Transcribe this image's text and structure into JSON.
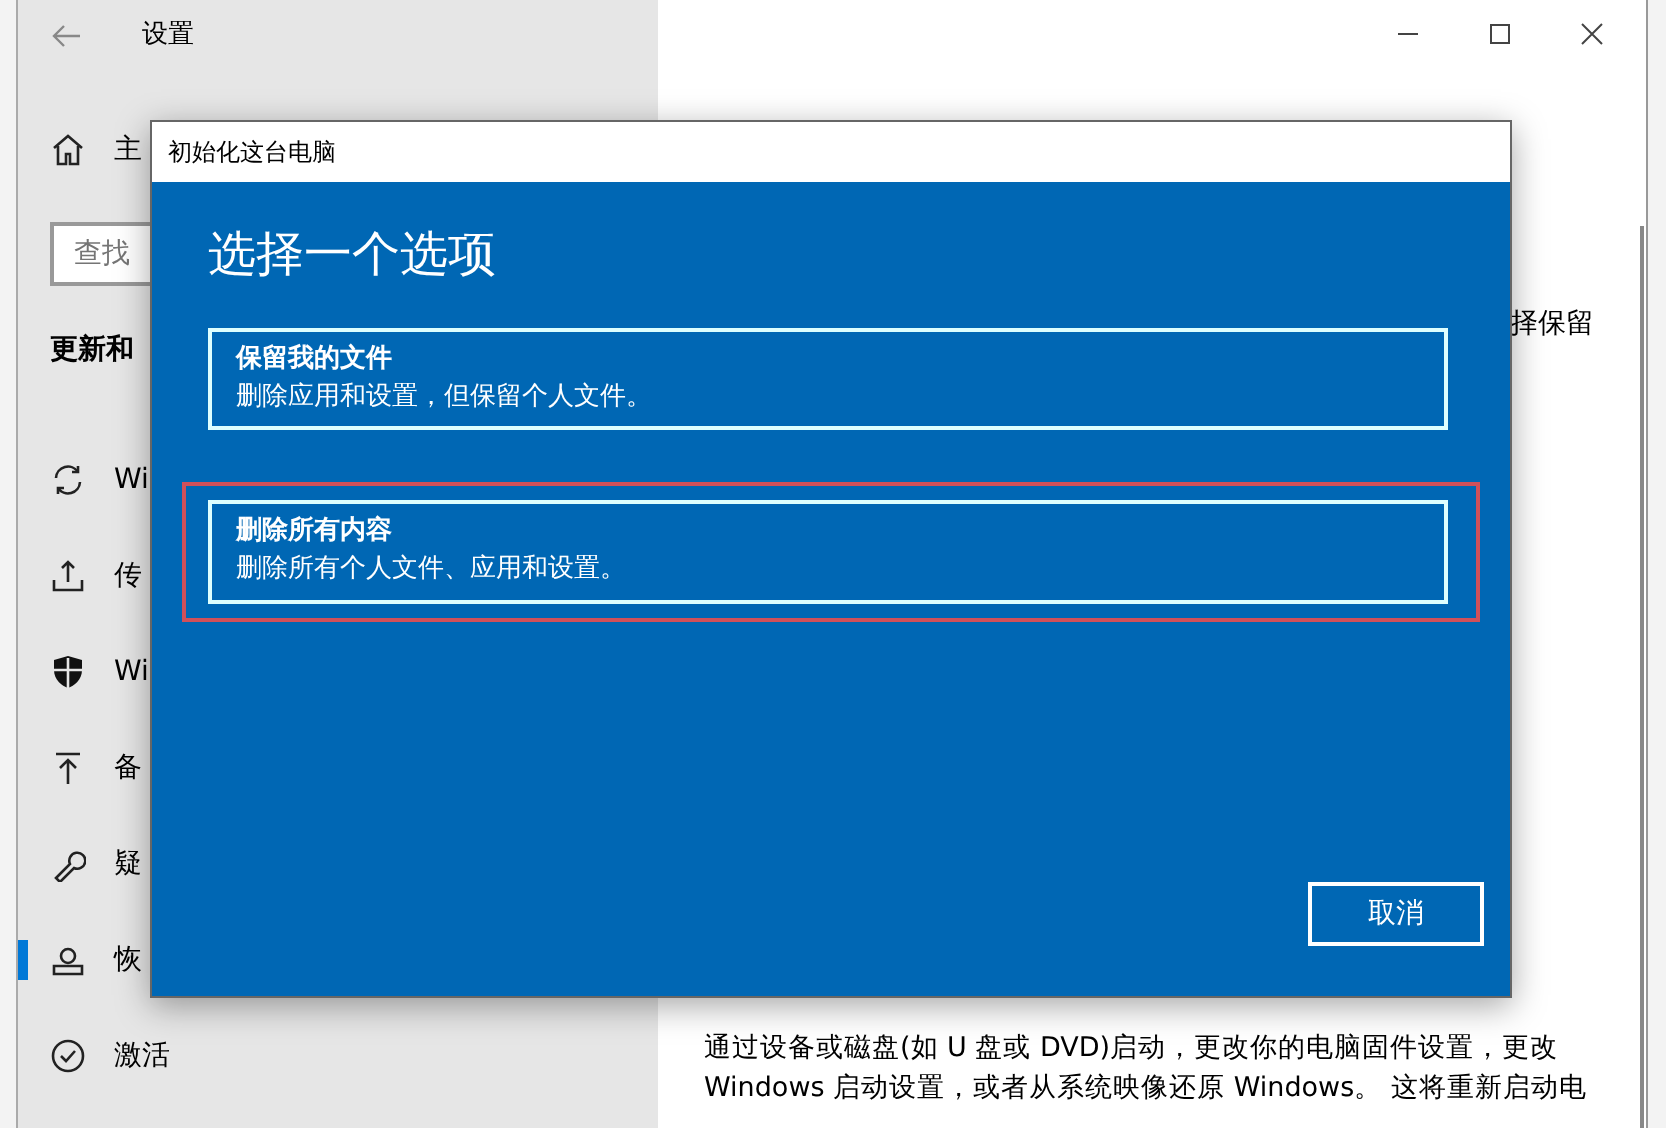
{
  "window": {
    "title": "设置"
  },
  "sidebar": {
    "home": "主",
    "search": {
      "placeholder": "查找"
    },
    "section": "更新和",
    "items": [
      {
        "kind": "sync",
        "label": "Wi",
        "selected": false
      },
      {
        "kind": "delivery",
        "label": "传",
        "selected": false
      },
      {
        "kind": "shield",
        "label": "Wi",
        "selected": false
      },
      {
        "kind": "backup",
        "label": "备",
        "selected": false
      },
      {
        "kind": "wrench",
        "label": "疑",
        "selected": false
      },
      {
        "kind": "recovery",
        "label": "恢",
        "selected": true
      },
      {
        "kind": "activation",
        "label": "激活",
        "selected": false
      }
    ]
  },
  "content": {
    "fragment": "择保留",
    "description": "通过设备或磁盘(如 U 盘或 DVD)启动，更改你的电脑固件设置，更改 Windows 启动设置，或者从系统映像还原 Windows。 这将重新启动电"
  },
  "dialog": {
    "title": "初始化这台电脑",
    "heading": "选择一个选项",
    "options": [
      {
        "title": "保留我的文件",
        "description": "删除应用和设置，但保留个人文件。",
        "highlighted": false
      },
      {
        "title": "删除所有内容",
        "description": "删除所有个人文件、应用和设置。",
        "highlighted": true
      }
    ],
    "cancel": "取消"
  }
}
